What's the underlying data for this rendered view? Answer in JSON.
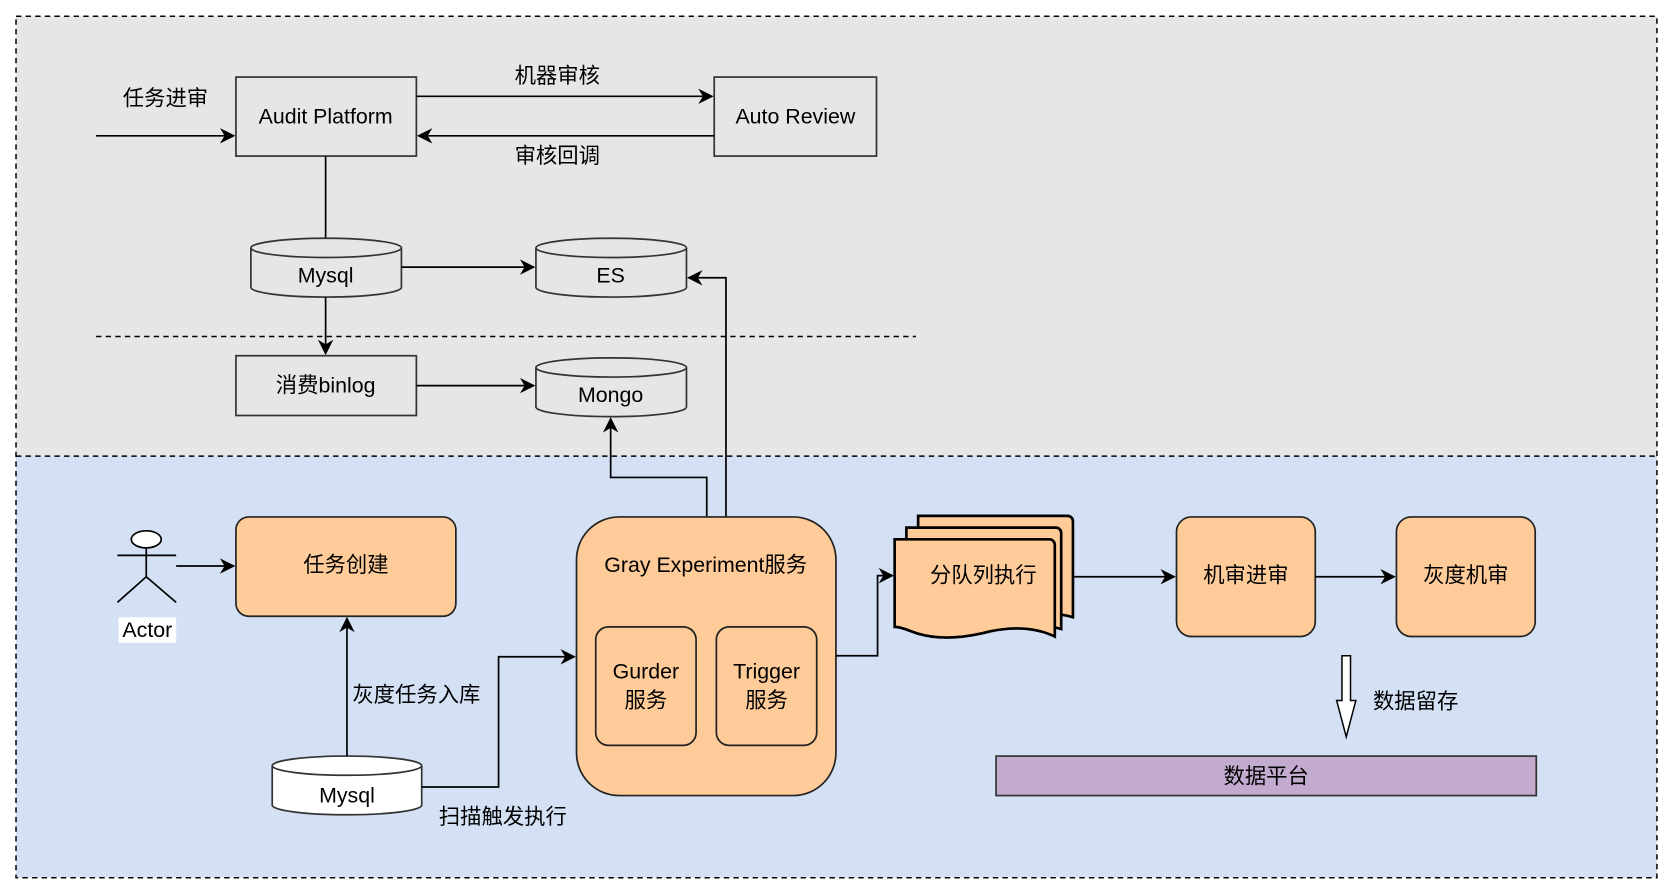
{
  "colors": {
    "upper_zone": "#e6e6e6",
    "lower_zone": "#d4e1f5",
    "service": "#ffcc99",
    "data_platform": "#c3abd0"
  },
  "upper": {
    "incoming_label": "任务进审",
    "audit_platform": "Audit Platform",
    "auto_review": "Auto Review",
    "machine_review_label": "机器审核",
    "callback_label": "审核回调",
    "mysql": "Mysql",
    "es": "ES",
    "binlog": "消费binlog",
    "mongo": "Mongo"
  },
  "lower": {
    "actor": "Actor",
    "task_create": "任务创建",
    "gray_experiment": "Gray Experiment服务",
    "gurder": [
      "Gurder",
      "服务"
    ],
    "trigger": [
      "Trigger",
      "服务"
    ],
    "mysql": "Mysql",
    "gray_store_label": "灰度任务入库",
    "scan_label": "扫描触发执行",
    "queue_exec": "分队列执行",
    "machine_enter": "机审进审",
    "gray_machine": "灰度机审",
    "retain_label": "数据留存",
    "data_platform": "数据平台"
  }
}
